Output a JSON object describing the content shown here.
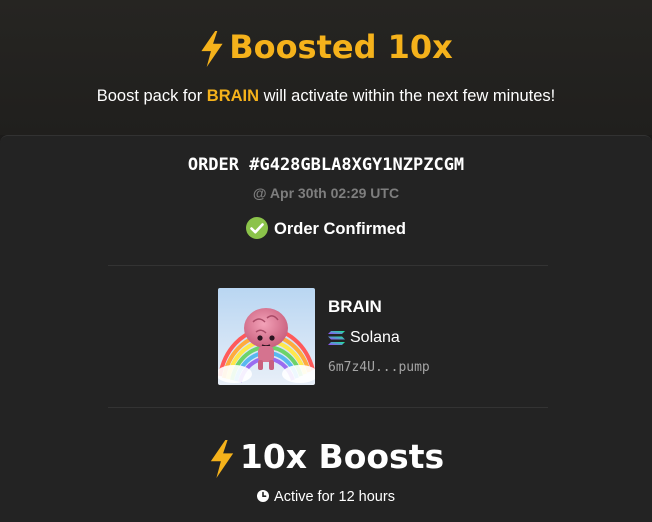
{
  "header": {
    "title": "Boosted 10x",
    "subtitle_prefix": "Boost pack for",
    "token_symbol": "BRAIN",
    "subtitle_suffix": "will activate within the next few minutes!"
  },
  "order": {
    "id": "ORDER #G428GBLA8XGY1NZPZCGM",
    "time": "@ Apr 30th 02:29 UTC",
    "status": "Order Confirmed"
  },
  "token": {
    "name": "BRAIN",
    "chain": "Solana",
    "address": "6m7z4U...pump"
  },
  "boost": {
    "title": "10x Boosts",
    "duration": "Active for 12 hours"
  },
  "colors": {
    "accent": "#f5b21b",
    "success": "#8bc34a",
    "background": "#1c1b1a",
    "card": "#232323"
  },
  "icons": {
    "title": "lightning-bolt-icon",
    "status": "check-circle-icon",
    "chain": "solana-logo-icon",
    "duration": "clock-icon"
  }
}
